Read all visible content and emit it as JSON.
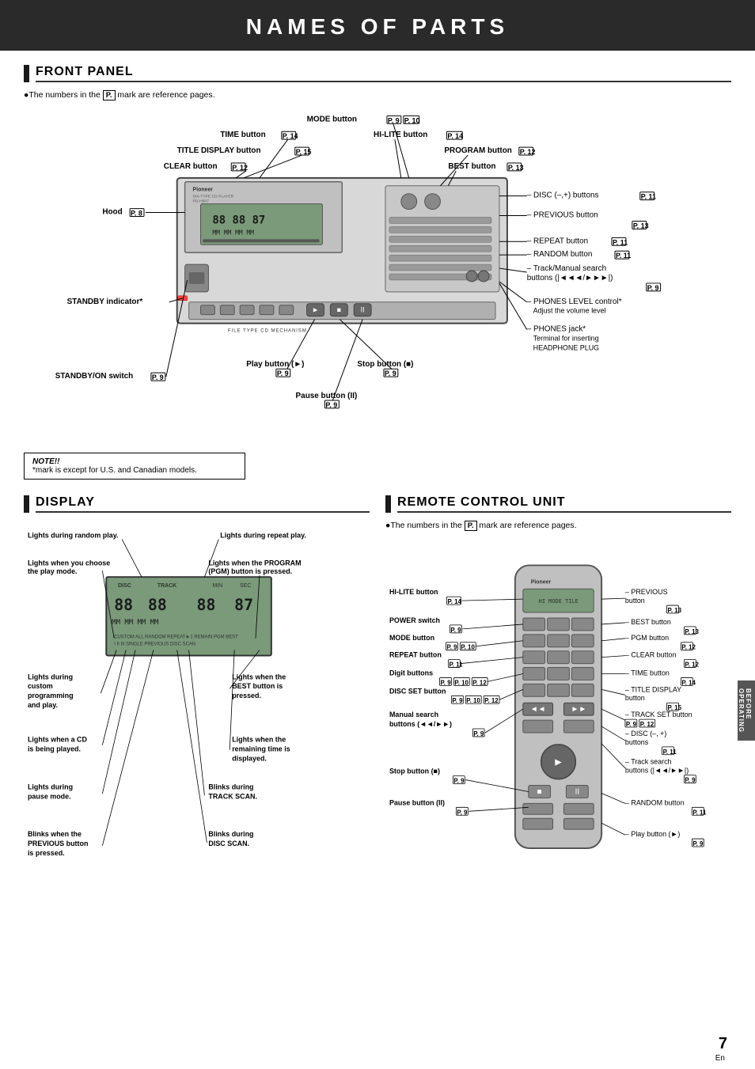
{
  "page": {
    "title": "NAMES  OF  PARTS",
    "number": "7",
    "en_label": "En"
  },
  "front_panel": {
    "section_title": "FRONT PANEL",
    "ref_note": "The numbers in the",
    "ref_mark": "P.",
    "ref_note2": "mark are reference pages.",
    "labels": {
      "mode_button": "MODE button",
      "mode_pages": "P. 9  P. 10",
      "time_button": "TIME button",
      "time_page": "P. 14",
      "hilite_button": "HI-LITE button",
      "hilite_page": "P. 14",
      "title_display": "TITLE DISPLAY button",
      "title_page": "P. 15",
      "program_button": "PROGRAM button",
      "program_page": "P. 12",
      "clear_button": "CLEAR button",
      "clear_page": "P. 12",
      "best_button": "BEST button",
      "best_page": "P. 13",
      "hood": "Hood",
      "hood_page": "P. 8",
      "disc_buttons": "DISC (–,+) buttons",
      "disc_page": "P. 11",
      "previous_button": "PREVIOUS button",
      "previous_page": "P. 13",
      "repeat_button": "REPEAT button",
      "repeat_page": "P. 11",
      "random_button": "RANDOM button",
      "random_page": "P. 11",
      "track_search": "Track/Manual search",
      "track_search2": "buttons (|◄◄◄/►►►|)",
      "track_page": "P. 9",
      "phones_level": "PHONES LEVEL control*",
      "phones_level_note": "Adjust the volume level",
      "phones_jack": "PHONES jack*",
      "phones_jack_note1": "Terminal for inserting",
      "phones_jack_note2": "HEADPHONE PLUG",
      "standby_indicator": "STANDBY indicator*",
      "standby_on": "STANDBY/ON switch",
      "standby_on_page": "P. 9",
      "play_button": "Play button (►)",
      "play_page": "P. 9",
      "stop_button": "Stop button (■)",
      "stop_page": "P. 9",
      "pause_button": "Pause button (II)",
      "pause_page": "P. 9",
      "note_title": "NOTE!!",
      "note_text": "*mark is except for U.S. and Canadian models."
    }
  },
  "display": {
    "section_title": "DISPLAY",
    "labels": {
      "random_play": "Lights during random play.",
      "repeat_play": "Lights during repeat play.",
      "play_mode": "Lights when you choose\nthe play mode.",
      "pgm_button": "Lights when the PROGRAM\n(PGM) button is pressed.",
      "custom_prog": "Lights during\ncustom\nprogramming\nand play.",
      "best_button": "Lights when the\nBEST button is\npressed.",
      "cd_playing": "Lights when a CD\nis being played.",
      "remaining_time": "Lights when the\nremaining time is\ndisplayed.",
      "pause_mode": "Lights during\npause mode.",
      "track_scan": "Blinks during\nTRACK SCAN.",
      "previous_blink": "Blinks when the\nPREVIOUS button\nis pressed.",
      "disc_scan": "Blinks during\nDISC SCAN.",
      "disc_label": "DISC",
      "track_label": "TRACK",
      "min_label": "MIN",
      "sec_label": "SEC",
      "custom_all": "CUSTOM ALL",
      "single_label": "SINGLE",
      "random_label": "RANDOM",
      "repeat_label": "REPEAT ► 1",
      "previous_label": "PREVIOUS DISC SCAN",
      "remain_label": "REMAIN",
      "pgm_label": "PGM",
      "best_label": "BEST"
    }
  },
  "remote": {
    "section_title": "REMOTE CONTROL UNIT",
    "ref_note": "The numbers in the",
    "ref_mark": "P.",
    "ref_note2": "mark are reference pages.",
    "labels": {
      "hilite_button": "HI-LITE button",
      "hilite_page": "P. 14",
      "previous_button": "PREVIOUS\nbutton",
      "previous_page": "P. 13",
      "power_switch": "POWER switch",
      "power_page": "P. 9",
      "best_button": "BEST button",
      "best_page": "P. 13",
      "mode_button": "MODE button",
      "mode_pages": "P. 9  P. 10",
      "pgm_button": "PGM button",
      "pgm_page": "P. 12",
      "repeat_button": "REPEAT button",
      "repeat_page": "P. 11",
      "clear_button": "CLEAR button",
      "clear_page": "P. 12",
      "digit_buttons": "Digit buttons",
      "digit_pages": "P. 9  P. 10  P. 12",
      "time_button": "TIME button",
      "time_page": "P. 14",
      "title_display": "TITLE DISPLAY\nbutton",
      "title_page": "P. 15",
      "disc_set": "DISC SET button",
      "disc_set_pages": "P. 9  P. 10  P. 12",
      "track_set": "TRACK SET button",
      "track_set_pages": "P. 9  P. 12",
      "manual_search": "Manual search\nbuttons (◄◄/►►)",
      "manual_page": "P. 9",
      "disc_buttons": "DISC (–, +)\nbuttons",
      "disc_page": "P. 11",
      "track_search": "Track search\nbuttons (|◄◄/►►|)",
      "track_page": "P. 9",
      "stop_button": "Stop button (■)",
      "stop_page": "P. 9",
      "random_button": "RANDOM button",
      "random_page": "P. 11",
      "pause_button": "Pause button (II)",
      "pause_page": "P. 9",
      "play_button": "Play button (►)",
      "play_page": "P. 9"
    }
  },
  "side_tab": {
    "line1": "BEFORE",
    "line2": "OPERATING"
  }
}
